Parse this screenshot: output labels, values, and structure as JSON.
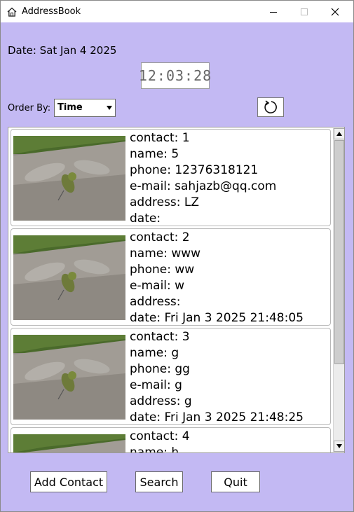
{
  "window": {
    "title": "AddressBook"
  },
  "header": {
    "date_text": "Date: Sat Jan 4 2025",
    "clock": "12:03:28"
  },
  "order": {
    "label": "Order By:",
    "value": "Time"
  },
  "contacts": [
    {
      "contact": "contact: 1",
      "name": "name: 5",
      "phone": "phone: 12376318121",
      "email": "e-mail: sahjazb@qq.com",
      "address": "address: LZ",
      "date": "date:"
    },
    {
      "contact": "contact: 2",
      "name": "name: www",
      "phone": "phone: ww",
      "email": "e-mail: w",
      "address": "address:",
      "date": "date: Fri Jan 3 2025 21:48:05"
    },
    {
      "contact": "contact: 3",
      "name": "name: g",
      "phone": "phone: gg",
      "email": "e-mail: g",
      "address": "address: g",
      "date": "date: Fri Jan 3 2025 21:48:25"
    },
    {
      "contact": "contact: 4",
      "name": "name: h"
    }
  ],
  "buttons": {
    "add": "Add Contact",
    "search": "Search",
    "quit": "Quit"
  }
}
